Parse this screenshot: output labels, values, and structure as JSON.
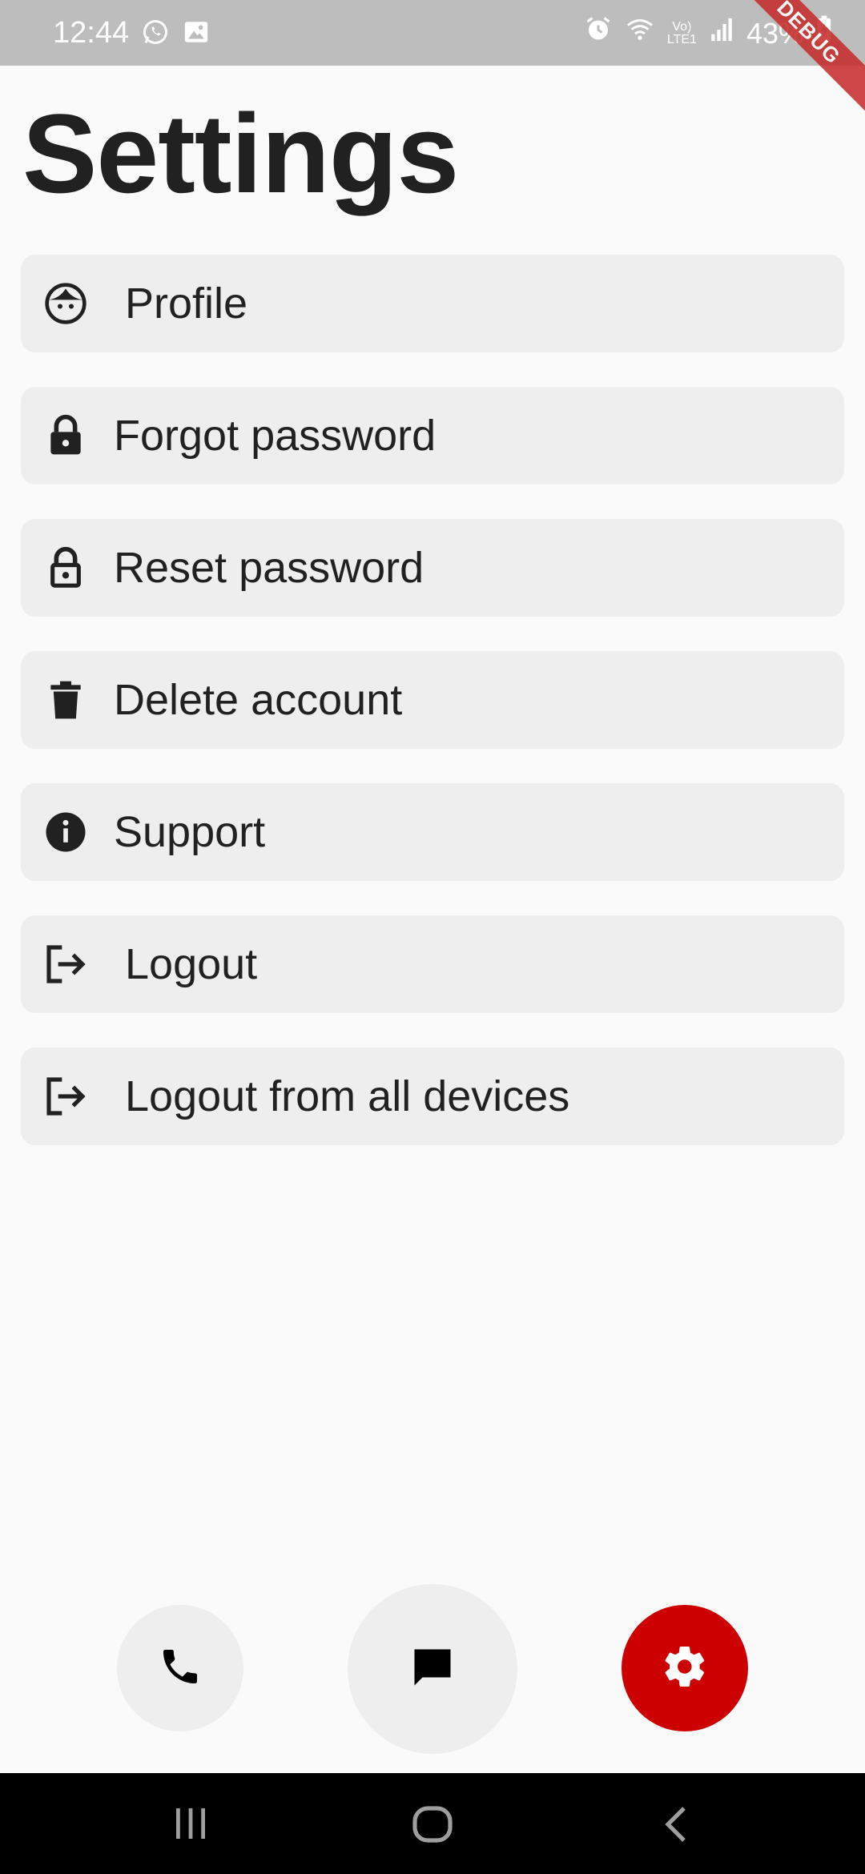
{
  "status_bar": {
    "time": "12:44",
    "battery": "43%",
    "left_icons": [
      "whatsapp-icon",
      "image-icon"
    ],
    "right_icons": [
      "alarm-icon",
      "wifi-icon",
      "volte-icon",
      "signal-icon",
      "battery-charging-icon"
    ],
    "debug_label": "DEBUG"
  },
  "page": {
    "title": "Settings"
  },
  "menu": {
    "items": [
      {
        "label": "Profile",
        "icon": "face-icon"
      },
      {
        "label": "Forgot password",
        "icon": "lock-icon"
      },
      {
        "label": "Reset password",
        "icon": "lock-open-icon"
      },
      {
        "label": "Delete account",
        "icon": "trash-icon"
      },
      {
        "label": "Support",
        "icon": "info-icon"
      },
      {
        "label": "Logout",
        "icon": "logout-icon"
      },
      {
        "label": "Logout from all devices",
        "icon": "logout-icon"
      }
    ]
  },
  "bottom_nav": {
    "items": [
      {
        "icon": "phone-icon",
        "active": false
      },
      {
        "icon": "chat-icon",
        "active": false
      },
      {
        "icon": "settings-icon",
        "active": true
      }
    ],
    "active_color": "#cc0000",
    "inactive_color": "#eeeeee"
  },
  "system_nav": {
    "buttons": [
      "recents-icon",
      "home-icon",
      "back-icon"
    ]
  }
}
